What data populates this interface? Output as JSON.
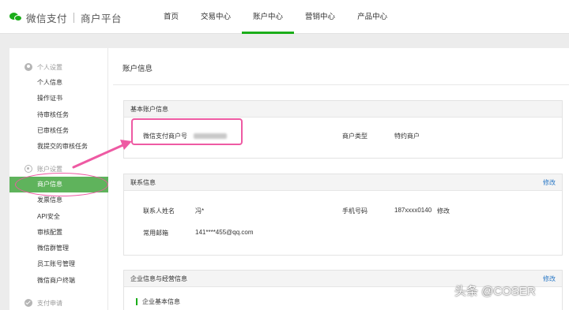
{
  "header": {
    "brand": "微信支付",
    "platform": "商户平台",
    "nav": [
      {
        "label": "首页",
        "active": false
      },
      {
        "label": "交易中心",
        "active": false
      },
      {
        "label": "账户中心",
        "active": true
      },
      {
        "label": "营销中心",
        "active": false
      },
      {
        "label": "产品中心",
        "active": false
      }
    ]
  },
  "sidebar": {
    "personal_group": "个人设置",
    "personal_items": [
      "个人信息",
      "操作证书",
      "待审核任务",
      "已审核任务",
      "我提交的审核任务"
    ],
    "account_group": "账户设置",
    "account_items": [
      "商户信息",
      "发票信息",
      "API安全",
      "审核配置",
      "微信群管理",
      "员工账号管理",
      "微信商户终端"
    ],
    "active_item": "商户信息",
    "payment_group": "支付申请"
  },
  "main": {
    "title": "账户信息",
    "basic": {
      "head": "基本账户信息",
      "merchant_id_label": "微信支付商户号",
      "merchant_type_label": "商户类型",
      "merchant_type_value": "特约商户"
    },
    "contact": {
      "head": "联系信息",
      "edit": "修改",
      "name_label": "联系人姓名",
      "name_value": "冯*",
      "phone_label": "手机号码",
      "phone_value": "187xxxx0140",
      "phone_edit": "修改",
      "email_label": "常用邮箱",
      "email_value": "141****455@qq.com"
    },
    "enterprise": {
      "head": "企业信息与经营信息",
      "edit": "修改",
      "sub": "企业基本信息"
    }
  },
  "watermark": "头条 @COSER",
  "colors": {
    "brand_green": "#1aad19",
    "active_bg": "#5fb35c",
    "link": "#2b79c6",
    "annotation": "#ee5aa3"
  }
}
